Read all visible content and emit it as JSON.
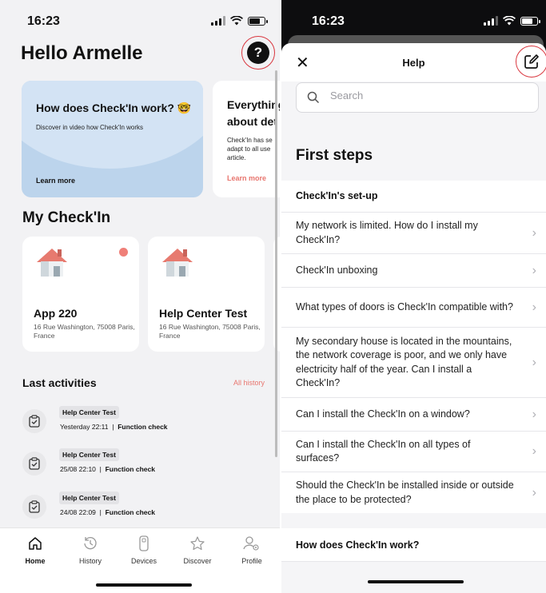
{
  "left": {
    "status_time": "16:23",
    "greeting": "Hello Armelle",
    "help_icon": "?",
    "promos": [
      {
        "title": "How does Check'In work? 🤓",
        "text": "Discover in video how Check'In works",
        "link": "Learn more"
      },
      {
        "title": "Everything about det",
        "text": "Check'In has se adapt to all use article.",
        "link": "Learn more"
      }
    ],
    "my_checkin_title": "My Check'In",
    "devices": [
      {
        "name": "App 220",
        "address": "16 Rue Washington, 75008 Paris, France"
      },
      {
        "name": "Help Center Test",
        "address": "16 Rue Washington, 75008 Paris, France"
      }
    ],
    "last_activities_title": "Last activities",
    "all_history": "All history",
    "activities": [
      {
        "tag": "Help Center Test",
        "date": "Yesterday 22:11",
        "sep": "|",
        "type": "Function check"
      },
      {
        "tag": "Help Center Test",
        "date": "25/08 22:10",
        "sep": "|",
        "type": "Function check"
      },
      {
        "tag": "Help Center Test",
        "date": "24/08 22:09",
        "sep": "|",
        "type": "Function check"
      }
    ],
    "tabs": [
      {
        "label": "Home",
        "icon": "home-icon"
      },
      {
        "label": "History",
        "icon": "history-icon"
      },
      {
        "label": "Devices",
        "icon": "devices-icon"
      },
      {
        "label": "Discover",
        "icon": "star-icon"
      },
      {
        "label": "Profile",
        "icon": "profile-icon"
      }
    ],
    "active_tab": "Home"
  },
  "right": {
    "status_time": "16:23",
    "title": "Help",
    "close": "✕",
    "search_placeholder": "Search",
    "section_title": "First steps",
    "category1": "Check'In's set-up",
    "questions": [
      "My network is limited. How do I install my Check'In?",
      "Check'In unboxing",
      "What types of doors is Check'In compatible with?",
      "My secondary house is located in the mountains, the network coverage is poor, and we only have electricity half of the year. Can I install a Check'In?",
      "Can I install the Check'In on a window?",
      "Can I install the Check'In on all types of surfaces?",
      "Should the Check'In be installed inside or outside the place to be protected?"
    ],
    "category2": "How does Check'In work?"
  },
  "colors": {
    "accent": "#e8766f",
    "promo_bg": "#bcd4ec",
    "highlight_ring": "#d9363e"
  }
}
